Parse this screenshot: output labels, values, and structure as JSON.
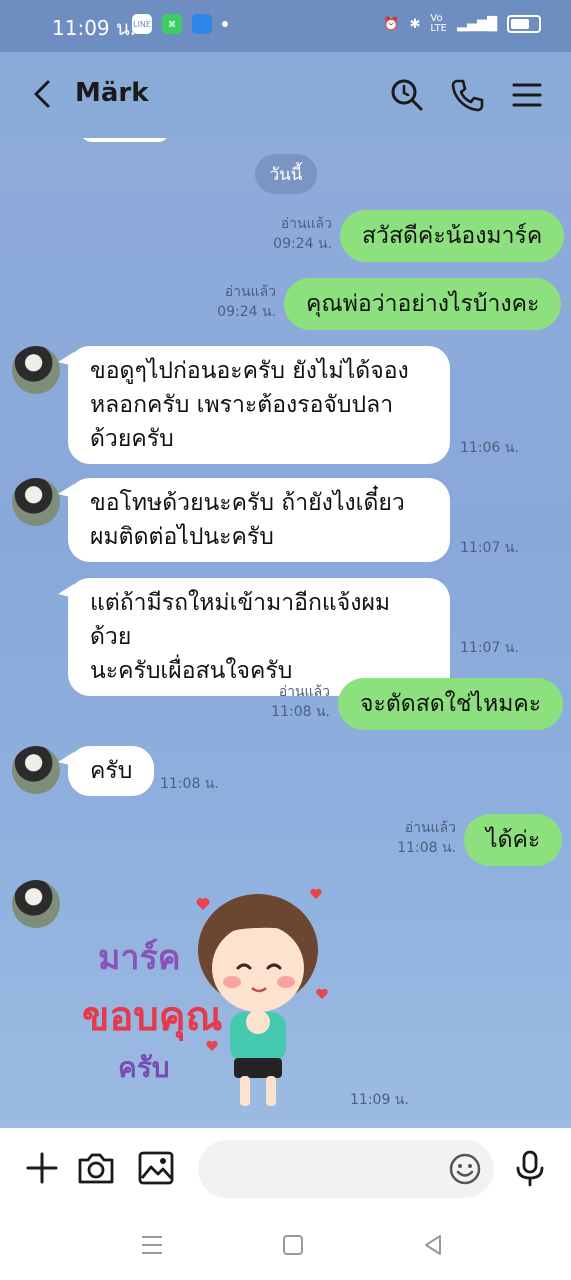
{
  "status_bar": {
    "time": "11:09 น.",
    "icons": [
      "line-app-icon",
      "app-icon",
      "app-icon",
      "dot-icon",
      "alarm-icon",
      "bluetooth-icon",
      "volte-icon",
      "signal-4g-icon",
      "battery-icon"
    ]
  },
  "header": {
    "contact_name": "Märk",
    "icons": [
      "back-icon",
      "search-icon",
      "call-icon",
      "menu-icon"
    ]
  },
  "chat": {
    "date_divider": "วันนี้",
    "messages": [
      {
        "dir": "out",
        "text": "สวัสดีค่ะน้องมาร์ค",
        "read": "อ่านแล้ว",
        "time": "09:24 น."
      },
      {
        "dir": "out",
        "text": "คุณพ่อว่าอย่างไรบ้างคะ",
        "read": "อ่านแล้ว",
        "time": "09:24 น."
      },
      {
        "dir": "in",
        "lines": [
          "ขอดูๆไปก่อนอะครับ ยังไม่ได้จอง",
          "หลอกครับ เพราะต้องรอจับปลา",
          "ด้วยครับ"
        ],
        "time": "11:06 น."
      },
      {
        "dir": "in",
        "lines": [
          "ขอโทษด้วยนะครับ ถ้ายังไงเดี๋ยว",
          "ผมติดต่อไปนะครับ"
        ],
        "time": "11:07 น."
      },
      {
        "dir": "in",
        "lines": [
          "แต่ถ้ามีรถใหม่เข้ามาอีกแจ้งผมด้วย",
          "นะครับเผื่อสนใจครับ"
        ],
        "time": "11:07 น."
      },
      {
        "dir": "out",
        "text": "จะตัดสดใช่ไหมคะ",
        "read": "อ่านแล้ว",
        "time": "11:08 น."
      },
      {
        "dir": "in",
        "lines": [
          "ครับ"
        ],
        "time": "11:08 น."
      },
      {
        "dir": "out",
        "text": "ได้ค่ะ",
        "read": "อ่านแล้ว",
        "time": "11:08 น."
      }
    ],
    "sticker": {
      "lines": [
        "มาร์ค",
        "ขอบคุณ",
        "ครับ"
      ],
      "time": "11:09 น."
    }
  },
  "input_bar": {
    "icons": [
      "plus-icon",
      "camera-icon",
      "image-icon",
      "emoji-icon",
      "mic-icon"
    ],
    "placeholder": ""
  },
  "nav_bar": {
    "icons": [
      "recent-apps-icon",
      "home-icon",
      "back-nav-icon"
    ]
  },
  "colors": {
    "chat_background": "#8aaad8",
    "outgoing_bubble": "#8de07e",
    "incoming_bubble": "#ffffff",
    "status_bar": "#6e8ec2"
  }
}
